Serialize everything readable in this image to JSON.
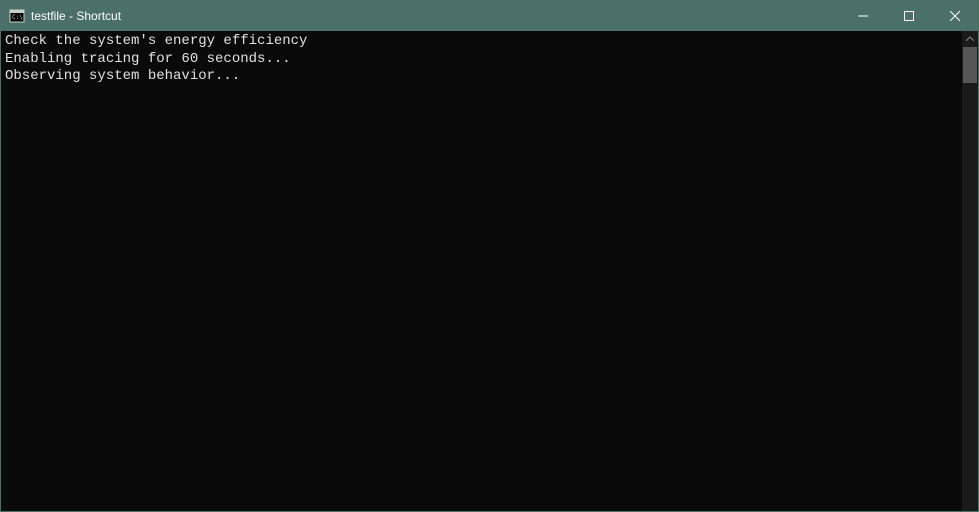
{
  "window": {
    "title": "testfile - Shortcut"
  },
  "console": {
    "lines": [
      "Check the system's energy efficiency",
      "Enabling tracing for 60 seconds...",
      "Observing system behavior..."
    ]
  }
}
